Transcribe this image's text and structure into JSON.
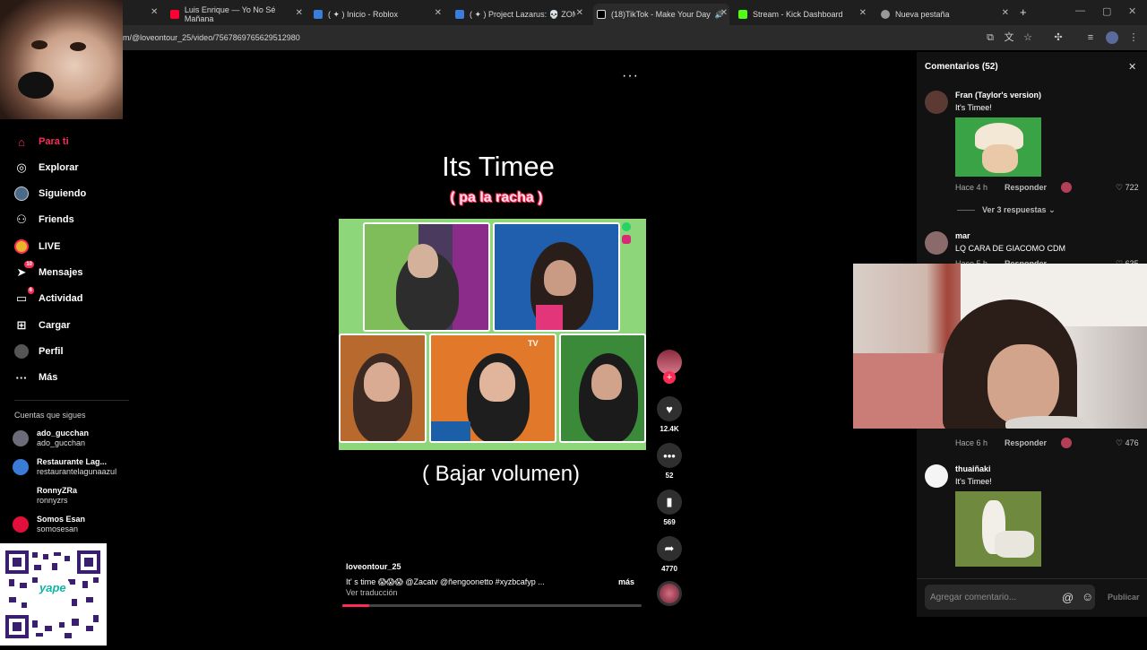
{
  "browser": {
    "tabs": [
      {
        "label": "Luis Enrique — Yo No Sé Mañana",
        "icon": "youtube-icon",
        "color": "#ff0033"
      },
      {
        "label": "( ✦ ) Inicio - Roblox",
        "icon": "roblox-icon",
        "color": "#3b7ddd"
      },
      {
        "label": "( ✦ ) Project Lazarus: 💀 ZOMBIES",
        "icon": "roblox-icon",
        "color": "#3b7ddd"
      },
      {
        "label": "(18)TikTok - Make Your Day",
        "icon": "tiktok-icon",
        "color": "#ffffff"
      },
      {
        "label": "Stream - Kick Dashboard",
        "icon": "kick-icon",
        "color": "#53fc18"
      },
      {
        "label": "Nueva pestaña",
        "icon": "globe-icon",
        "color": "#aaaaaa"
      }
    ],
    "new_tab": "+",
    "url": "m/@loveontour_25/video/7567869765629512980"
  },
  "sidebar": {
    "nav": [
      {
        "label": "Para ti",
        "icon": "home-icon",
        "glyph": "⌂"
      },
      {
        "label": "Explorar",
        "icon": "compass-icon",
        "glyph": "◎"
      },
      {
        "label": "Siguiendo",
        "icon": "following-icon",
        "glyph": "●"
      },
      {
        "label": "Friends",
        "icon": "friends-icon",
        "glyph": "👥"
      },
      {
        "label": "LIVE",
        "icon": "live-icon",
        "glyph": "●"
      },
      {
        "label": "Mensajes",
        "icon": "messages-icon",
        "glyph": "➤",
        "badge": "10"
      },
      {
        "label": "Actividad",
        "icon": "activity-icon",
        "glyph": "▭",
        "badge": "6"
      },
      {
        "label": "Cargar",
        "icon": "upload-icon",
        "glyph": "⊞"
      },
      {
        "label": "Perfil",
        "icon": "profile-icon",
        "glyph": "●"
      },
      {
        "label": "Más",
        "icon": "more-icon",
        "glyph": "···"
      }
    ],
    "following_title": "Cuentas que sigues",
    "accounts": [
      {
        "name": "ado_gucchan",
        "handle": "ado_gucchan",
        "color": "#6b6b7a"
      },
      {
        "name": "Restaurante Lag...",
        "handle": "restaurantelagunaazul",
        "color": "#3a7bd5"
      },
      {
        "name": "RonnyZRa",
        "handle": "ronnyzrs",
        "color": "#000000"
      },
      {
        "name": "Somos Esan",
        "handle": "somosesan",
        "color": "#e0103a"
      }
    ],
    "qr_brand": "yape"
  },
  "video": {
    "title": "Its Timee",
    "subtitle": "( pa la racha )",
    "caption": "( Bajar volumen)",
    "overlay_label": "TV",
    "author": "loveontour_25",
    "description": "It' s time 😱😱😱  @Zacatv  @ñengoonetto   #xyzbcafyp  ...",
    "more": "más",
    "translate": "Ver traducción",
    "progress_fraction": 0.09
  },
  "actions": {
    "follow": "+",
    "likes": "12.4K",
    "comments": "52",
    "saves": "569",
    "shares": "4770"
  },
  "comments_panel": {
    "title": "Comentarios (52)",
    "items": [
      {
        "user": "Fran (Taylor's version)",
        "text": "It's Timee!",
        "time": "Hace 4 h",
        "reply": "Responder",
        "likes": "722"
      },
      {
        "view_replies": "Ver 3 respuestas"
      },
      {
        "user": "mar",
        "text": "LQ CARA DE GIACOMO CDM",
        "time": "Hace 5 h",
        "reply": "Responder",
        "likes": "635"
      },
      {
        "time": "Hace 6 h",
        "reply": "Responder",
        "likes": "476"
      },
      {
        "user": "thuaiñaki",
        "text": "It's Timee!"
      }
    ],
    "input_placeholder": "Agregar comentario...",
    "publish": "Publicar"
  }
}
